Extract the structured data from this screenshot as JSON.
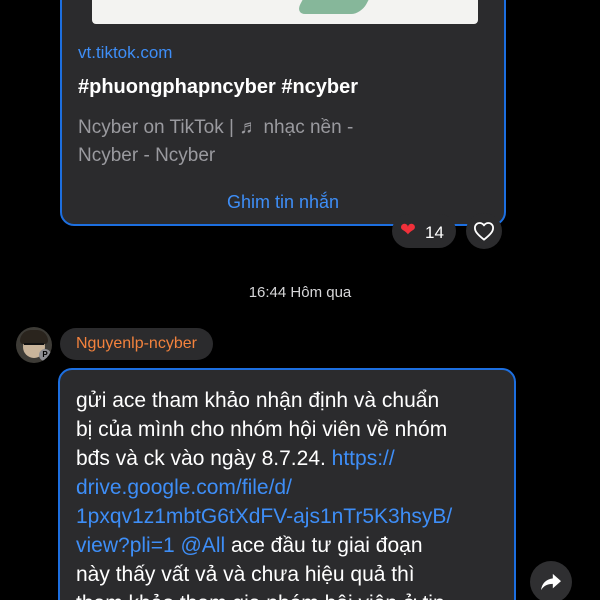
{
  "link_message": {
    "domain": "vt.tiktok.com",
    "title": "#phuongphapncyber #ncyber",
    "description_line1": "Ncyber  on TikTok | ♬ nhạc nền -",
    "description_line2": "Ncyber - Ncyber",
    "pin_label": "Ghim tin nhắn",
    "reaction_icon": "heart",
    "reaction_count": "14",
    "react_button_icon": "heart-outline-icon"
  },
  "timestamp": "16:44 Hôm qua",
  "sender": {
    "name": "Nguyenlp-ncyber",
    "avatar_badge": "P",
    "name_color": "#f3823d"
  },
  "message": {
    "line1": "gửi ace tham khảo nhận định và chuẩn",
    "line2": "bị của mình cho nhóm hội viên về nhóm",
    "line3_text": "bđs và ck vào ngày 8.7.24. ",
    "line3_link": "https://",
    "line4_link": "drive.google.com/file/d/",
    "line5_link": "1pxqv1z1mbtG6tXdFV-ajs1nTr5K3hsyB/",
    "line6_link": "view?pli=1",
    "line6_mention": " @All",
    "line6_text": "  ace đầu tư giai đoạn",
    "line7": "này thấy vất vả và chưa hiệu quả thì",
    "line8": "tham khảo tham gia nhóm hội viên ở tin"
  },
  "colors": {
    "background": "#000000",
    "bubble": "#2b2b2d",
    "bubble_border": "#1d6fe0",
    "link": "#3e8ef7",
    "heart": "#f0303a"
  },
  "forward_button_icon": "share-forward-icon"
}
